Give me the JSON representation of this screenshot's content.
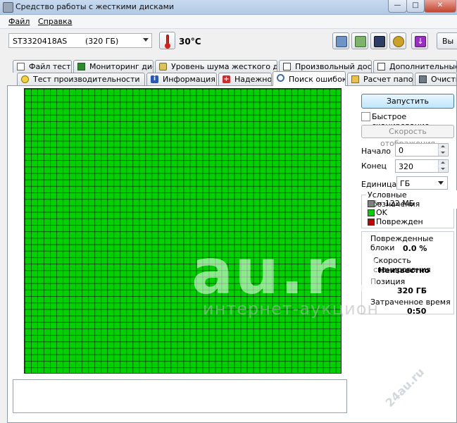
{
  "window": {
    "title": "Средство работы с жесткими дисками"
  },
  "menu": {
    "file": "Файл",
    "help": "Справка"
  },
  "toolbar": {
    "drive_model": "ST3320418AS",
    "drive_size": "(320 ГБ)",
    "temperature": "30°C",
    "exit_label": "Вы"
  },
  "tabs_row1": [
    {
      "label": "Файл теста",
      "icon": "file-icon"
    },
    {
      "label": "Мониторинг диска",
      "icon": "chart-icon"
    },
    {
      "label": "Уровень шума жесткого диска",
      "icon": "speaker-icon"
    },
    {
      "label": "Произвольный доступ",
      "icon": "document-icon"
    },
    {
      "label": "Дополнительные тесты",
      "icon": "document-icon"
    }
  ],
  "tabs_row2": [
    {
      "label": "Тест производительности",
      "icon": "lightbulb-icon"
    },
    {
      "label": "Информация",
      "icon": "info-icon"
    },
    {
      "label": "Надежность",
      "icon": "cross-icon"
    },
    {
      "label": "Поиск ошибок",
      "icon": "magnifier-icon",
      "active": true
    },
    {
      "label": "Расчет папок",
      "icon": "folder-icon"
    },
    {
      "label": "Очистка",
      "icon": "trash-icon"
    }
  ],
  "error_scan": {
    "start_button": "Запустить",
    "quick_scan_label": "Быстрое сканирование",
    "quick_scan_checked": false,
    "display_speed_button": "Скорость отображения",
    "start_label": "Начало",
    "start_value": "0",
    "end_label": "Конец",
    "end_value": "320",
    "unit_label": "Единица",
    "unit_value": "ГБ",
    "legend": {
      "title": "Условные обозначения",
      "block_size": "= 122 МБ",
      "ok": "OK",
      "damaged": "Поврежден",
      "colors": {
        "block": "#808080",
        "ok": "#00d200",
        "damaged": "#c00000"
      }
    },
    "stats": {
      "damaged_blocks_label": "Поврежденные блоки",
      "damaged_blocks_value": "0.0 %",
      "scan_speed_label": "Скорость сканирования",
      "scan_speed_value": "Неизвестно",
      "position_label": "Позиция",
      "position_value": "320 ГБ",
      "elapsed_label": "Затраченное время",
      "elapsed_value": "0:50"
    },
    "grid_color": "#00d200"
  },
  "watermark": {
    "main": "au.ru",
    "sub": "интернет-аукцион",
    "corner": "24au.ru"
  }
}
